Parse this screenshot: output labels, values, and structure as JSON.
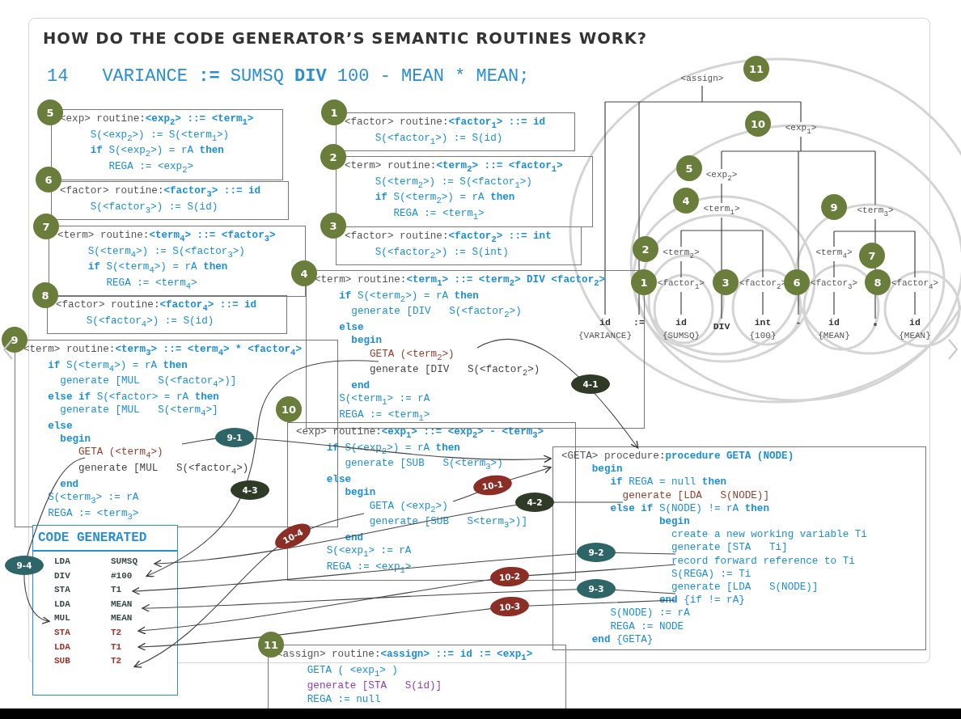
{
  "title": "HOW DO THE CODE GENERATOR’S SEMANTIC ROUTINES WORK?",
  "statement": {
    "line_number": "14",
    "code": "VARIANCE **:=** SUMSQ **DIV** 100 - MEAN * MEAN;"
  },
  "routines": [
    {
      "badge": "5",
      "heading": "<exp> routine:",
      "rule": "<exp$_{2}$> ::= <term$_{1}$>",
      "lines": [
        {
          "kind": "code",
          "text": "     S(<exp$_{2}$>) := S(<term$_{1}$>)"
        },
        {
          "kind": "code",
          "text": "     **if** S(<exp$_{2}$>) = rA **then**"
        },
        {
          "kind": "code",
          "text": "        REGA := <exp$_{2}$>"
        }
      ]
    },
    {
      "badge": "6",
      "heading": "<factor> routine:",
      "rule": "<factor$_{3}$> ::= id",
      "lines": [
        {
          "kind": "code",
          "text": "     S(<factor$_{3}$>) := S(id)"
        }
      ]
    },
    {
      "badge": "7",
      "heading": "<term> routine:",
      "rule": "<term$_{4}$> ::= <factor$_{3}$>",
      "lines": [
        {
          "kind": "code",
          "text": "     S(<term$_{4}$>) := S(<factor$_{3}$>)"
        },
        {
          "kind": "code",
          "text": "     **if** S(<term$_{4}$>) = rA **then**"
        },
        {
          "kind": "code",
          "text": "        REGA := <term$_{4}$>"
        }
      ]
    },
    {
      "badge": "8",
      "heading": "<factor> routine:",
      "rule": "<factor$_{4}$> ::= id",
      "lines": [
        {
          "kind": "code",
          "text": "     S(<factor$_{4}$>) := S(id)"
        }
      ]
    },
    {
      "badge": "1",
      "heading": "<factor> routine:",
      "rule": "<factor$_{1}$> ::= id",
      "lines": [
        {
          "kind": "code",
          "text": "     S(<factor$_{1}$>) := S(id)"
        }
      ]
    },
    {
      "badge": "2",
      "heading": "<term> routine:",
      "rule": "<term$_{2}$> ::= <factor$_{1}$>",
      "lines": [
        {
          "kind": "code",
          "text": "     S(<term$_{2}$>) := S(<factor$_{1}$>)"
        },
        {
          "kind": "code",
          "text": "     **if** S(<term$_{2}$>) = rA **then**"
        },
        {
          "kind": "code",
          "text": "        REGA := <term$_{1}$>"
        }
      ]
    },
    {
      "badge": "3",
      "heading": "<factor> routine:",
      "rule": "<factor$_{2}$> ::= int",
      "lines": [
        {
          "kind": "code",
          "text": "     S(<factor$_{2}$>) := S(int)"
        }
      ]
    },
    {
      "badge": "4",
      "heading": "<term> routine:",
      "rule": "<term$_{1}$> ::= <term$_{2}$> DIV <factor$_{2}$>",
      "lines": [
        {
          "kind": "code",
          "text": "    **if** S(<term$_{2}$>) = rA **then**"
        },
        {
          "kind": "code",
          "text": "      generate [DIV   S(<factor$_{2}$>)"
        },
        {
          "kind": "keyword",
          "text": "    else"
        },
        {
          "kind": "keyword",
          "text": "      begin"
        },
        {
          "kind": "call",
          "text": "         GETA (<term$_{2}$>)"
        },
        {
          "kind": "plain",
          "text": "         generate [DIV   S(<factor$_{2}$>)"
        },
        {
          "kind": "keyword",
          "text": "      end"
        },
        {
          "kind": "code",
          "text": "    S(<term$_{1}$> := rA"
        },
        {
          "kind": "code",
          "text": "    REGA := <term$_{1}$>"
        }
      ]
    },
    {
      "badge": "9",
      "heading": "<term> routine:",
      "rule": "<term$_{3}$> ::= <term$_{4}$> * <factor$_{4}$>",
      "lines": [
        {
          "kind": "code",
          "text": "    **if** S(<term$_{4}$>) = rA **then**"
        },
        {
          "kind": "code",
          "text": "      generate [MUL   S(<factor$_{4}$>)]"
        },
        {
          "kind": "code",
          "text": "    **else if** S(<factor> = rA **then**"
        },
        {
          "kind": "code",
          "text": "      generate [MUL   S(<term$_{4}$>]"
        },
        {
          "kind": "keyword",
          "text": "    else"
        },
        {
          "kind": "keyword",
          "text": "      begin"
        },
        {
          "kind": "call",
          "text": "         GETA (<term$_{4}$>)"
        },
        {
          "kind": "plain",
          "text": "         generate [MUL   S(<factor$_{4}$>)"
        },
        {
          "kind": "keyword",
          "text": "      end"
        },
        {
          "kind": "code",
          "text": "    S(<term$_{3}$> := rA"
        },
        {
          "kind": "code",
          "text": "    REGA := <term$_{3}$>"
        }
      ]
    },
    {
      "badge": "10",
      "heading": "<exp> routine:",
      "rule": "<exp$_{1}$> ::= <exp$_{2}$> - <term$_{3}$>",
      "lines": [
        {
          "kind": "code",
          "text": "     **if** S(<exp$_{2}$>) = rA **then**"
        },
        {
          "kind": "code",
          "text": "        generate [SUB   S(<term$_{3}$>)"
        },
        {
          "kind": "keyword",
          "text": "     else"
        },
        {
          "kind": "keyword",
          "text": "        begin"
        },
        {
          "kind": "code",
          "text": "            GETA (<exp$_{2}$>)"
        },
        {
          "kind": "code",
          "text": "            generate [SUB   S<term$_{3}$>)]"
        },
        {
          "kind": "keyword",
          "text": "        end"
        },
        {
          "kind": "code",
          "text": "     S(<exp$_{1}$> := rA"
        },
        {
          "kind": "code",
          "text": "     REGA := <exp$_{1}$>"
        }
      ]
    },
    {
      "heading": "<GETA> procedure:",
      "rule": "procedure GETA (NODE)",
      "lines": [
        {
          "kind": "keyword",
          "text": "     begin"
        },
        {
          "kind": "code",
          "text": "        **if** REGA = null **then**"
        },
        {
          "kind": "call",
          "text": "          generate [LDA   S(NODE)]"
        },
        {
          "kind": "code",
          "text": "        **else if** S(NODE) != rA **then**"
        },
        {
          "kind": "keyword",
          "text": "                begin"
        },
        {
          "kind": "code",
          "text": "                  create a new working variable Ti"
        },
        {
          "kind": "code",
          "text": "                  generate [STA   Ti]"
        },
        {
          "kind": "code",
          "text": "                  record forward reference to Ti"
        },
        {
          "kind": "code",
          "text": "                  S(REGA) := Ti"
        },
        {
          "kind": "code",
          "text": "                  generate [LDA   S(NODE)]"
        },
        {
          "kind": "code",
          "text": "                **end** {if != rA}"
        },
        {
          "kind": "code",
          "text": "        S(NODE) := rA"
        },
        {
          "kind": "code",
          "text": "        REGA := NODE"
        },
        {
          "kind": "code",
          "text": "     **end** {GETA}"
        }
      ]
    },
    {
      "badge": "11",
      "heading": "<assign> routine:",
      "rule": "<assign> ::= id := <exp$_{1}$>",
      "lines": [
        {
          "kind": "code",
          "text": "     GETA ( <exp$_{1}$> )"
        },
        {
          "kind": "emit",
          "text": "     generate [STA   S(id)]"
        },
        {
          "kind": "code",
          "text": "     REGA := null"
        }
      ]
    }
  ],
  "parse_tree": {
    "kind": "nonterminal",
    "label": "<assign>",
    "badge": "11",
    "children": [
      {
        "kind": "leaf",
        "label": "id",
        "value": "{VARIANCE}"
      },
      {
        "kind": "token",
        "label": ":="
      },
      {
        "kind": "nonterminal",
        "label": "<exp$_{1}$>",
        "badge": "10",
        "children": [
          {
            "kind": "nonterminal",
            "label": "<exp$_{2}$>",
            "badge": "5",
            "children": [
              {
                "kind": "nonterminal",
                "label": "<term$_{1}$>",
                "badge": "4",
                "children": [
                  {
                    "kind": "nonterminal",
                    "label": "<term$_{2}$>",
                    "badge": "2",
                    "children": [
                      {
                        "kind": "nonterminal",
                        "label": "<factor$_{1}$>",
                        "badge": "1",
                        "children": [
                          {
                            "kind": "leaf",
                            "label": "id",
                            "value": "{SUMSQ}"
                          }
                        ]
                      }
                    ]
                  },
                  {
                    "kind": "token",
                    "label": "DIV"
                  },
                  {
                    "kind": "nonterminal",
                    "label": "<factor$_{2}$>",
                    "badge": "3",
                    "children": [
                      {
                        "kind": "leaf",
                        "label": "int",
                        "value": "{100}"
                      }
                    ]
                  }
                ]
              }
            ]
          },
          {
            "kind": "token",
            "label": "-"
          },
          {
            "kind": "nonterminal",
            "label": "<term$_{3}$>",
            "badge": "9",
            "children": [
              {
                "kind": "nonterminal",
                "label": "<term$_{4}$>",
                "badge": "7",
                "children": [
                  {
                    "kind": "nonterminal",
                    "label": "<factor$_{3}$>",
                    "badge": "6",
                    "children": [
                      {
                        "kind": "leaf",
                        "label": "id",
                        "value": "{MEAN}"
                      }
                    ]
                  }
                ]
              },
              {
                "kind": "token",
                "label": "*"
              },
              {
                "kind": "nonterminal",
                "label": "<factor$_{4}$>",
                "badge": "8",
                "children": [
                  {
                    "kind": "leaf",
                    "label": "id",
                    "value": "{MEAN}"
                  }
                ]
              }
            ]
          }
        ]
      }
    ]
  },
  "code_generated": {
    "title": "CODE GENERATED",
    "rows": [
      {
        "op": "LDA",
        "operand": "SUMSQ",
        "color": "#3d4a4a"
      },
      {
        "op": "DIV",
        "operand": "#100",
        "color": "#3d4a4a"
      },
      {
        "op": "STA",
        "operand": "T1",
        "color": "#3d4a4a"
      },
      {
        "op": "LDA",
        "operand": "MEAN",
        "color": "#3d4a4a"
      },
      {
        "op": "MUL",
        "operand": "MEAN",
        "color": "#3d4a4a"
      },
      {
        "op": "STA",
        "operand": "T2",
        "color": "#a0332b"
      },
      {
        "op": "LDA",
        "operand": "T1",
        "color": "#a0332b"
      },
      {
        "op": "SUB",
        "operand": "T2",
        "color": "#a0332b"
      }
    ]
  },
  "step_labels": [
    {
      "label": "4-1",
      "color": "#2f3b27"
    },
    {
      "label": "9-1",
      "color": "#2e6566"
    },
    {
      "label": "10-1",
      "color": "#8a2e26"
    },
    {
      "label": "4-2",
      "color": "#2f3b27"
    },
    {
      "label": "4-3",
      "color": "#2f3b27"
    },
    {
      "label": "9-2",
      "color": "#2e6566"
    },
    {
      "label": "9-3",
      "color": "#2e6566"
    },
    {
      "label": "9-4",
      "color": "#2e6566"
    },
    {
      "label": "10-2",
      "color": "#8a2e26"
    },
    {
      "label": "10-3",
      "color": "#8a2e26"
    },
    {
      "label": "10-4",
      "color": "#8a2e26"
    }
  ]
}
